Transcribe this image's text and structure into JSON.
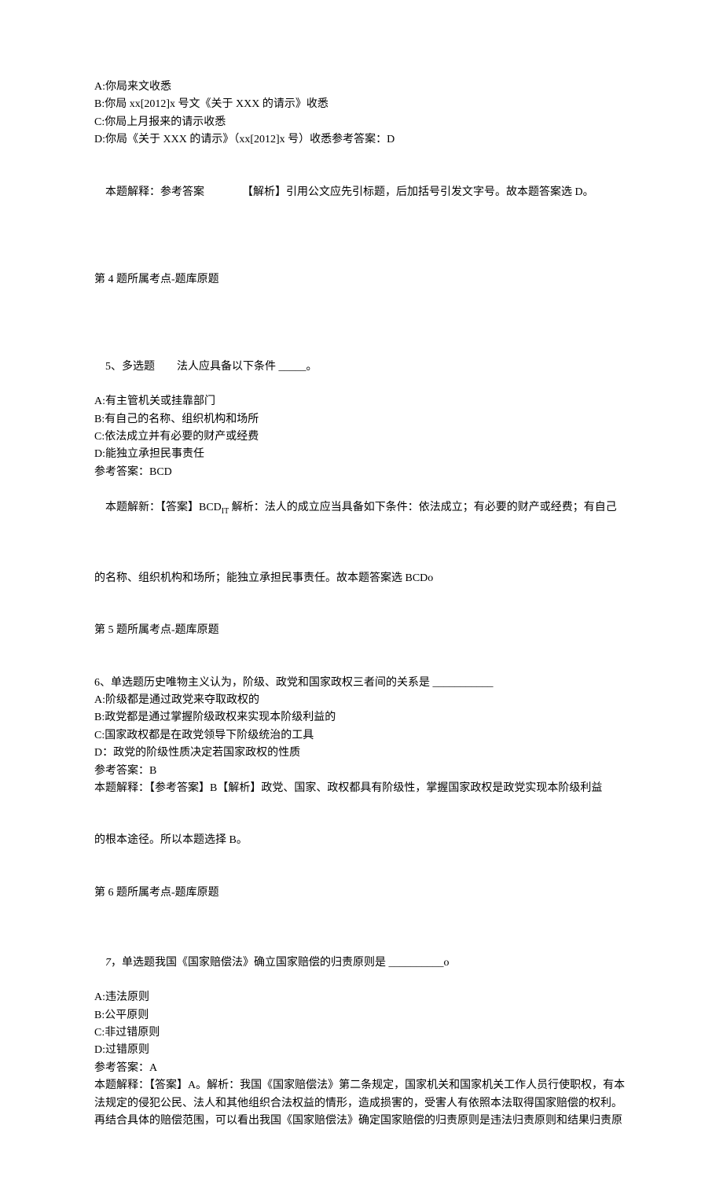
{
  "q4": {
    "opt_a": "A:你局来文收悉",
    "opt_b": "B:你局 xx[2012]x 号文《关于 XXX 的请示》收悉",
    "opt_c": "C:你局上月报来的请示收悉",
    "opt_d": "D:你局《关于 XXX 的请示》（xx[2012]x 号）收悉参考答案：D",
    "explain_label": "本题解释：参考答案",
    "explain_body": "【解析】引用公文应先引标题，后加括号引发文字号。故本题答案选 D。",
    "topic": "第 4 题所属考点-题库原题"
  },
  "q5": {
    "stem_prefix": "5、多选题",
    "stem_body": "法人应具备以下条件 _____。",
    "opt_a": "A:有主管机关或挂靠部门",
    "opt_b": "B:有自己的名称、组织机构和场所",
    "opt_c": "C:依法成立并有必要的财产或经费",
    "opt_d": "D:能独立承担民事责任",
    "answer": "参考答案：BCD",
    "explain_line1_a": "本题解新：【答案】BCD",
    "explain_line1_sub": "IT",
    "explain_line1_b": " 解析：法人的成立应当具备如下条件：依法成立；有必要的财产或经费；有自己",
    "explain_line2": "的名称、组织机构和场所；能独立承担民事责任。故本题答案选 BCDo",
    "topic": "第 5 题所属考点-题库原题"
  },
  "q6": {
    "stem": "6、单选题历史唯物主义认为，阶级、政党和国家政权三者间的关系是 ___________",
    "opt_a": "A:阶级都是通过政党来夺取政权的",
    "opt_b": "B:政党都是通过掌握阶级政权来实现本阶级利益的",
    "opt_c": "C:国家政权都是在政党领导下阶级统治的工具",
    "opt_d": "D：政党的阶级性质决定若国家政权的性质",
    "answer": "参考答案：B",
    "explain_line1": "本题解释：【参考答案】B【解析】政党、国家、政权都具有阶级性，掌握国家政权是政党实现本阶级利益",
    "explain_line2": "的根本途径。所以本题选择 B。",
    "topic": "第 6 题所属考点-题库原题"
  },
  "q7": {
    "stem_num": "7",
    "stem_body": "单选题我国《国家赔偿法》确立国家赔偿的归责原则是 __________o",
    "opt_a": "A:违法原则",
    "opt_b": "B:公平原则",
    "opt_c": "C:非过错原则",
    "opt_d": "D:过错原则",
    "answer": "参考答案：A",
    "explain_line1": "本题解释：【答案】A。解析：我国《国家赔偿法》第二条规定，国家机关和国家机关工作人员行使职权，有本",
    "explain_line2": "法规定的侵犯公民、法人和其他组织合法权益的情形，造成损害的，受害人有依照本法取得国家赔偿的权利。",
    "explain_line3": "再结合具体的赔偿范围，可以看出我国《国家赔偿法》确定国家赔偿的归责原则是违法归责原则和结果归责原"
  }
}
